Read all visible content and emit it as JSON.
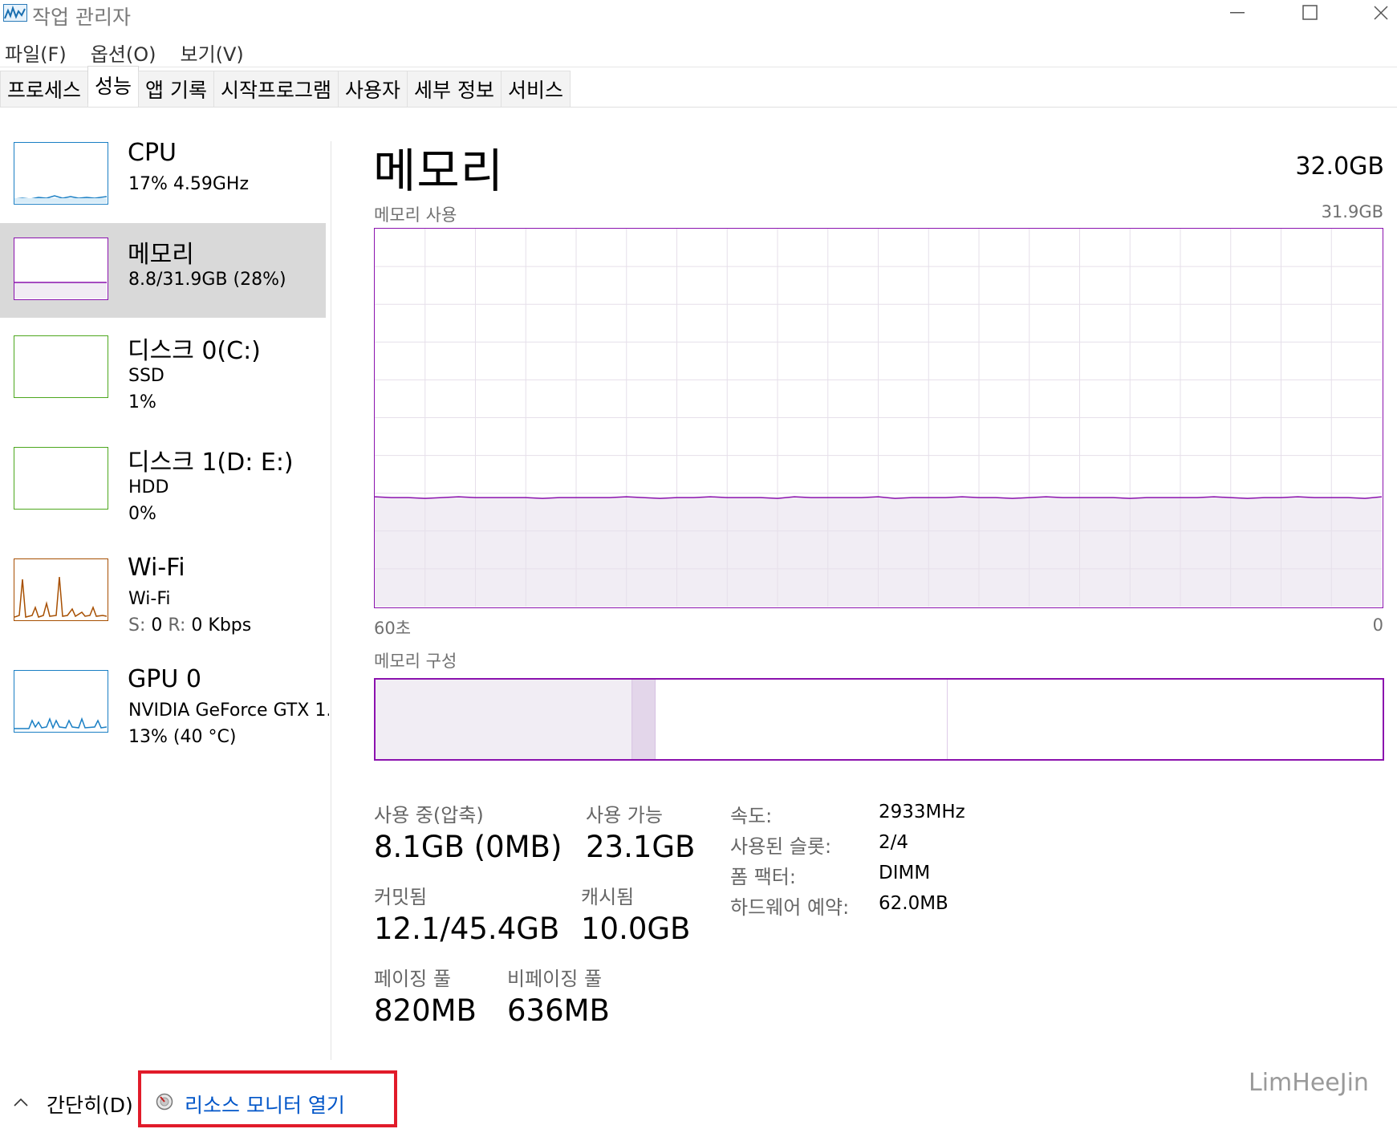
{
  "window": {
    "title": "작업 관리자",
    "icon": "task-manager-icon",
    "controls": {
      "minimize": "—",
      "maximize": "☐",
      "close": "✕"
    }
  },
  "menu": [
    "파일(F)",
    "옵션(O)",
    "보기(V)"
  ],
  "tabs": [
    {
      "label": "프로세스",
      "active": false
    },
    {
      "label": "성능",
      "active": true
    },
    {
      "label": "앱 기록",
      "active": false
    },
    {
      "label": "시작프로그램",
      "active": false
    },
    {
      "label": "사용자",
      "active": false
    },
    {
      "label": "세부 정보",
      "active": false
    },
    {
      "label": "서비스",
      "active": false
    }
  ],
  "sidebar": {
    "items": [
      {
        "title": "CPU",
        "line1": "17% 4.59GHz",
        "line2": "",
        "color": "#1a7fc4",
        "selected": false
      },
      {
        "title": "메모리",
        "line1": "8.8/31.9GB (28%)",
        "line2": "",
        "color": "#8b12ae",
        "selected": true
      },
      {
        "title": "디스크 0(C:)",
        "line1": "SSD",
        "line2": "1%",
        "color": "#4da71e",
        "selected": false
      },
      {
        "title": "디스크 1(D: E:)",
        "line1": "HDD",
        "line2": "0%",
        "color": "#4da71e",
        "selected": false
      },
      {
        "title": "Wi-Fi",
        "line1": "Wi-Fi",
        "line2_label_s": "S:",
        "line2_val_s": "0",
        "line2_label_r": "R:",
        "line2_val_r": "0 Kbps",
        "color": "#a74f01",
        "selected": false
      },
      {
        "title": "GPU 0",
        "line1": "NVIDIA GeForce GTX 1...",
        "line2": "13% (40 °C)",
        "color": "#1a7fc4",
        "selected": false
      }
    ]
  },
  "main": {
    "title": "메모리",
    "total": "32.0GB",
    "usage_chart": {
      "label": "메모리 사용",
      "max_label": "31.9GB",
      "x_left": "60초",
      "x_right": "0",
      "usage_fraction": 0.28,
      "line_color": "#8b12ae"
    },
    "composition": {
      "label": "메모리 구성",
      "in_use_fraction": 0.255,
      "modified_fraction": 0.023,
      "standby_fraction": 0.29,
      "free_fraction": 0.432
    },
    "stats": {
      "in_use_label": "사용 중(압축)",
      "in_use_value": "8.1GB (0MB)",
      "available_label": "사용 가능",
      "available_value": "23.1GB",
      "committed_label": "커밋됨",
      "committed_value": "12.1/45.4GB",
      "cached_label": "캐시됨",
      "cached_value": "10.0GB",
      "paged_label": "페이징 풀",
      "paged_value": "820MB",
      "nonpaged_label": "비페이징 풀",
      "nonpaged_value": "636MB"
    },
    "details": [
      {
        "label": "속도:",
        "value": "2933MHz"
      },
      {
        "label": "사용된 슬롯:",
        "value": "2/4"
      },
      {
        "label": "폼 팩터:",
        "value": "DIMM"
      },
      {
        "label": "하드웨어 예약:",
        "value": "62.0MB"
      }
    ]
  },
  "footer": {
    "brief_label": "간단히(D)",
    "resource_monitor_label": "리소스 모니터 열기"
  },
  "watermark": "LimHeeJin"
}
